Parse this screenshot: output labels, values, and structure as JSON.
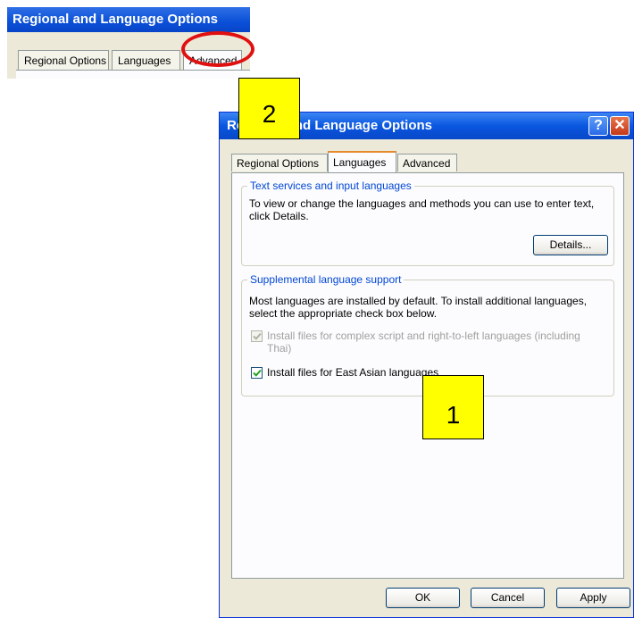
{
  "top_window": {
    "title": "Regional and Language Options",
    "tabs": [
      "Regional Options",
      "Languages",
      "Advanced"
    ]
  },
  "dialog": {
    "title": "Regional and Language Options",
    "tabs": [
      "Regional Options",
      "Languages",
      "Advanced"
    ],
    "active_tab": "Languages",
    "text_services": {
      "title": "Text services and input languages",
      "text": "To view or change the languages and methods you can use to enter text, click Details.",
      "details_button": "Details..."
    },
    "supplemental": {
      "title": "Supplemental language support",
      "text": "Most languages are installed by default. To install additional languages, select the appropriate check box below.",
      "complex_script": {
        "label": "Install files for complex script and right-to-left languages (including Thai)",
        "checked": true,
        "disabled": true
      },
      "east_asian": {
        "label": "Install files for East Asian languages",
        "checked": true,
        "disabled": false
      }
    },
    "buttons": {
      "ok": "OK",
      "cancel": "Cancel",
      "apply": "Apply"
    }
  },
  "callouts": {
    "one": "1",
    "two": "2"
  },
  "colors": {
    "highlight_ring": "#e01010",
    "callout_fill": "#ffff00",
    "titlebar": "#0a57e0"
  }
}
